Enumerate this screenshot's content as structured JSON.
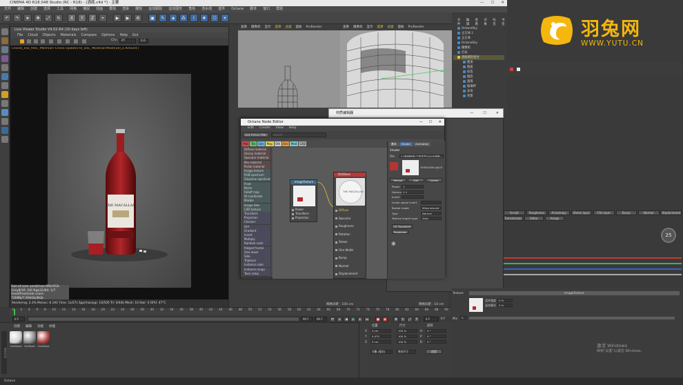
{
  "app": {
    "title": "CINEMA 4D R18.048 Studio (RC - R18) - [酒瓶.c4d *] - 主要",
    "menu": [
      "文件",
      "编辑",
      "创建",
      "选择",
      "工具",
      "网格",
      "捕捉",
      "动画",
      "模拟",
      "渲染",
      "雕刻",
      "运动跟踪",
      "运动图形",
      "角色",
      "流水线",
      "插件",
      "Octane",
      "脚本",
      "窗口",
      "帮助"
    ]
  },
  "toolbar": {
    "buttons": [
      "撤销",
      "重做",
      "选择",
      "移动",
      "缩放",
      "旋转",
      "X",
      "Y",
      "Z",
      "坐标",
      "渲染",
      "渲染活动",
      "渲染设置",
      "立方体",
      "画笔",
      "细分",
      "克隆",
      "变形",
      "场景",
      "摄像机",
      "灯光"
    ],
    "accent": "#e5c640"
  },
  "live_viewer": {
    "title": "Live Viewer Studio V4.02-R4 (10 days left)",
    "menu": [
      "File",
      "Cloud",
      "Objects",
      "Materials",
      "Compare",
      "Options",
      "Help",
      "Gui"
    ],
    "status_line": "Check[_link_files_:Mesh(all:-Check Update(:0)_link_:Mode(all:Mesh(all)_e.Actived:]",
    "channel_label": "Chn",
    "channel_value": "PT",
    "zoom_value": "0.6",
    "info_lines": [
      "Out-of-core used/max:0Kb/4Gb",
      "Grey8/16: 0/0        Rgb32/64: 1/7",
      "Used/free/total vram: 726Mb/7.694Gb/8Gb"
    ],
    "bottom_line": "Rendering: 2.3%   Ms/sec: 6.193   Time: 1s/27s   Spp/maxspp: 14/500   Tri: 0/44k   Mesh: 10   Hair: 0   GPU: 47°C",
    "bottle_label": "THE MACALLAN"
  },
  "viewport": {
    "left_bar": [
      "查看",
      "摄像机",
      "显示",
      "选项",
      "过滤",
      "面板",
      "ProRender"
    ],
    "right_bar": [
      "查看",
      "摄像机",
      "显示",
      "选项",
      "过滤",
      "面板",
      "ProRender"
    ],
    "grid_left": "网格间距 : 100 cm",
    "grid_right": "网格间距 : 10 cm"
  },
  "object_manager": {
    "menu": [
      "文件",
      "编辑",
      "查看",
      "对象",
      "标签",
      "书签"
    ],
    "objects": [
      "OctaneSky",
      "立方体.1",
      "立方体",
      "OctaneSky",
      "摄像机",
      "灯光",
      "酒瓶模型组合",
      "瓶身",
      "瓶盖",
      "标签",
      "瓶底",
      "酒液",
      "玻璃杯",
      "冰块",
      "背景"
    ]
  },
  "node_editor": {
    "title": "Octane Node Editor",
    "menu": [
      "Edit",
      "Create",
      "View",
      "Help"
    ],
    "get_active_mat": "Get Active Mat",
    "search_placeholder": "Search",
    "tags": [
      "Mat",
      "Tex",
      "Gen",
      "Map",
      "Oth",
      "Emi",
      "Med",
      "C4D"
    ],
    "tag_colors": [
      "#d84c4c",
      "#69c06b",
      "#6bb3dc",
      "#e3d25a",
      "#c9c9c9",
      "#e89b3b",
      "#7cc8c8",
      "#aaaaaa"
    ],
    "materials_list": [
      "Diffuse material",
      "Glossy material",
      "Specular material",
      "Mix material",
      "Portal material",
      "Image texture",
      "RGB spectrum",
      "Gaussian spectrum",
      "Float",
      "Noise",
      "Falloff map",
      "W coordinate",
      "Marble",
      "Image tiles",
      "C4D texture",
      "Transform",
      "Projection",
      "Checker",
      "Dirt",
      "Gradient",
      "Invert",
      "Multiply",
      "Random color",
      "Ridged fractal",
      "Sine wave",
      "Side",
      "Triplanar",
      "Instance color",
      "Instance range",
      "Toon ramp"
    ],
    "image_node": {
      "title": "ImageTexture",
      "pins": [
        "Power",
        "Transform",
        "Projection"
      ]
    },
    "material_node": {
      "title": "OctGloss",
      "pins": [
        "Diffuse",
        "Specular",
        "Roughness",
        "Rotation",
        "Sheen",
        "Film Width",
        "Bump",
        "Normal",
        "Displacement"
      ],
      "preview_text": "THE MACALLAN"
    },
    "shader_panel": {
      "tabs": [
        "基本",
        "Shader",
        "Animation"
      ],
      "section": "Shader",
      "file_label": "File",
      "file_path": "C:\\贴图材质\\工程文件\\2019\\酒瓶.jpg",
      "image_info": "2000x2000,rgb24",
      "buttons": [
        "Reload",
        "Edit",
        "Locate"
      ],
      "fields": [
        {
          "label": "Power",
          "value": "1."
        },
        {
          "label": "Gamma",
          "value": "2.2"
        },
        {
          "label": "Invert",
          "value": ""
        },
        {
          "label": "Linear space invert",
          "value": ""
        },
        {
          "label": "Border mode",
          "value": "Wrap around"
        },
        {
          "label": "Type",
          "value": "Normal"
        },
        {
          "label": "Texture import type",
          "value": "Auto"
        }
      ],
      "transform_button": "UV Transform",
      "projection_button": "Projection"
    }
  },
  "property_window": {
    "title": "材质编辑器"
  },
  "timeline": {
    "ticks": [
      "0",
      "2",
      "4",
      "6",
      "8",
      "10",
      "12",
      "14",
      "16",
      "18",
      "20",
      "22",
      "24",
      "26",
      "28",
      "30",
      "32",
      "34",
      "36",
      "38",
      "40",
      "42",
      "44",
      "46",
      "48",
      "50",
      "52",
      "54",
      "56",
      "58",
      "60",
      "62",
      "64",
      "66",
      "68",
      "70",
      "72",
      "74",
      "76",
      "78",
      "80",
      "82",
      "84",
      "86",
      "88",
      "90"
    ],
    "start": "0 F",
    "current": "0 F",
    "end": "90 F",
    "end2": "90 F",
    "frame_readout": "0 F"
  },
  "material_manager": {
    "menu": [
      "创建",
      "编辑",
      "功能",
      "纹理"
    ],
    "materials": [
      {
        "name": "OctGloss",
        "color": "#cfcfcf"
      },
      {
        "name": "OctSpec",
        "color": "#8a8a8a"
      },
      {
        "name": "OctGloss",
        "color": "#b04040"
      }
    ]
  },
  "coordinates": {
    "headers": [
      "位置",
      "尺寸",
      "旋转"
    ],
    "rows": [
      {
        "axis": "X",
        "pos": "0 cm",
        "size": "100 %",
        "rot_label": "H",
        "rot": "0 °"
      },
      {
        "axis": "Y",
        "pos": "0.475",
        "size": "100 %",
        "rot_label": "P",
        "rot": "0 °"
      },
      {
        "axis": "Z",
        "pos": "0 cm",
        "size": "100 %",
        "rot_label": "B",
        "rot": "0 °"
      }
    ],
    "mode": "对象 (相对)",
    "size_mode": "绝对尺寸",
    "apply": "应用"
  },
  "attributes": {
    "tabs": [
      "Scrajit",
      "Roughness",
      "Anisotropy",
      "Sheen layer",
      "Film layer",
      "Bump",
      "Normal",
      "Displacement"
    ],
    "sub_tabs": [
      "Transmission",
      "Editor",
      "Assign"
    ],
    "texture_label": "Texture",
    "texture_value": "ImageTexture",
    "mix_label": "混合强度",
    "mix_value": "0 %",
    "mix2_label": "混合模式",
    "mix2_value": "0 %",
    "mix3_label": "Mix",
    "mix3_value": "0."
  },
  "activate": {
    "line1": "激活 Windows",
    "line2": "转到\"设置\"以激活 Windows。"
  },
  "status": {
    "text": "Octane"
  },
  "badge": "25",
  "watermark": {
    "cn": "羽兔网",
    "url": "WWW.YUTU.CN",
    "color": "#f5b70d"
  }
}
